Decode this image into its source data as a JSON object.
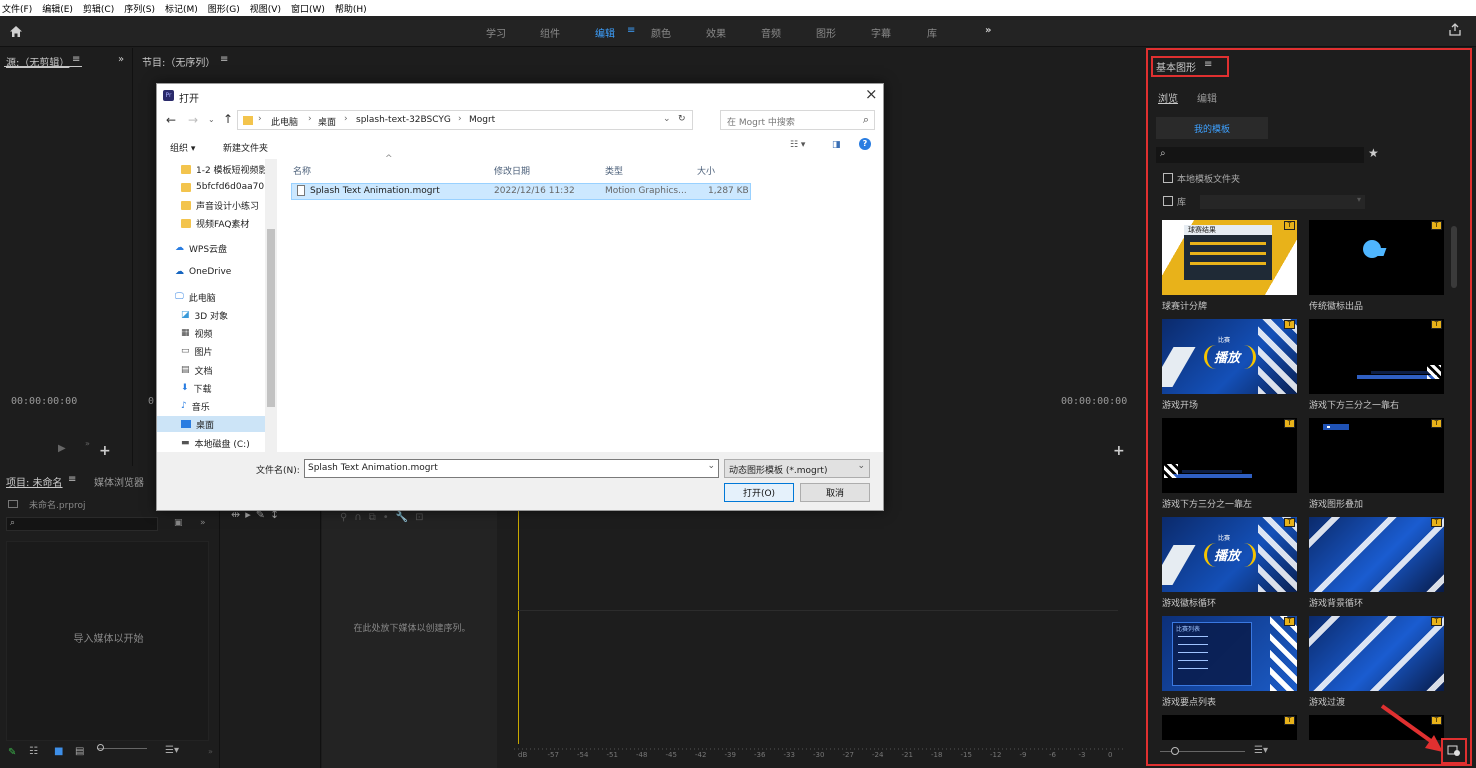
{
  "menu": [
    "文件(F)",
    "编辑(E)",
    "剪辑(C)",
    "序列(S)",
    "标记(M)",
    "图形(G)",
    "视图(V)",
    "窗口(W)",
    "帮助(H)"
  ],
  "workspaces": [
    "学习",
    "组件",
    "编辑",
    "颜色",
    "效果",
    "音频",
    "图形",
    "字幕",
    "库"
  ],
  "workspace_more": "»",
  "source_panel": {
    "title": "源:（无剪辑）",
    "menu": "≡",
    "more": "»",
    "timecode": "00:00:00:00"
  },
  "program_panel": {
    "title": "节目:（无序列）",
    "menu": "≡",
    "timecode": "00:00:00:00",
    "tc2": "0"
  },
  "project_panel": {
    "tab1": "项目: 未命名",
    "tab1_menu": "≡",
    "tab2": "媒体浏览器",
    "file": "未命名.prproj",
    "empty": "导入媒体以开始",
    "seq_empty": "在此处放下媒体以创建序列。"
  },
  "audio_meter": {
    "ticks": [
      "dB",
      "-57",
      "-54",
      "-51",
      "-48",
      "-45",
      "-42",
      "-39",
      "-36",
      "-33",
      "-30",
      "-27",
      "-24",
      "-21",
      "-18",
      "-15",
      "-12",
      "-9",
      "-6",
      "-3",
      "0"
    ]
  },
  "eg_panel": {
    "title": "基本图形",
    "title_menu": "≡",
    "tabs": [
      "浏览",
      "编辑"
    ],
    "my_templates": "我的模板",
    "search_placeholder": "",
    "local_folder": "本地模板文件夹",
    "library": "库",
    "templates": [
      {
        "name": "球赛计分牌",
        "style": "scoreboard"
      },
      {
        "name": "传统徽标出品",
        "style": "logo"
      },
      {
        "name": "游戏开场",
        "style": "play"
      },
      {
        "name": "游戏下方三分之一靠右",
        "style": "lower-right"
      },
      {
        "name": "游戏下方三分之一靠左",
        "style": "lower-left"
      },
      {
        "name": "游戏图形叠加",
        "style": "overlay"
      },
      {
        "name": "游戏徽标循环",
        "style": "play"
      },
      {
        "name": "游戏背景循环",
        "style": "stripes"
      },
      {
        "name": "游戏要点列表",
        "style": "list"
      },
      {
        "name": "游戏过渡",
        "style": "stripes"
      }
    ],
    "tile_texts": {
      "play_small": "比赛",
      "play_big": "播放",
      "list_title": "比赛列表",
      "score_title": "球赛结果"
    }
  },
  "dialog": {
    "title": "打开",
    "app_icon": "Pr",
    "breadcrumb": [
      "此电脑",
      "桌面",
      "splash-text-32BSCYG",
      "Mogrt"
    ],
    "search_placeholder": "在 Mogrt 中搜索",
    "toolbar": {
      "organize": "组织 ▾",
      "new_folder": "新建文件夹"
    },
    "tree": [
      "1-2 模板短视频影",
      "5bfcfd6d0aa70",
      "声音设计小练习",
      "视频FAQ素材",
      "WPS云盘",
      "OneDrive",
      "此电脑",
      "3D 对象",
      "视频",
      "图片",
      "文档",
      "下载",
      "音乐",
      "桌面",
      "本地磁盘 (C:)"
    ],
    "columns": [
      "名称",
      "修改日期",
      "类型",
      "大小"
    ],
    "files": [
      {
        "name": "Splash Text Animation.mogrt",
        "date": "2022/12/16 11:32",
        "type": "Motion Graphics...",
        "size": "1,287 KB"
      }
    ],
    "filename_label": "文件名(N):",
    "filename": "Splash Text Animation.mogrt",
    "filetype": "动态图形模板 (*.mogrt)",
    "open": "打开(O)",
    "cancel": "取消"
  },
  "colors": {
    "accent": "#3ea1ff",
    "highlight": "#e03030",
    "bg": "#1d1d1d",
    "panel": "#232323",
    "badge": "#e8b21a"
  }
}
